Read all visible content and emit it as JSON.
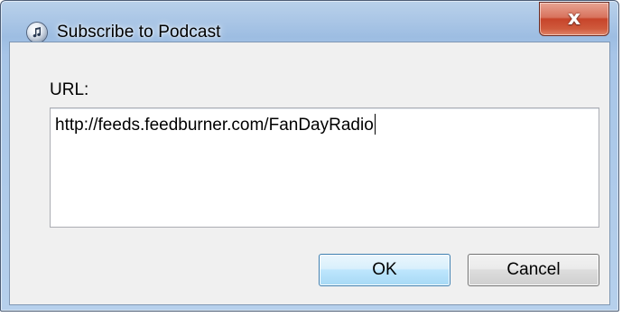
{
  "window": {
    "title": "Subscribe to Podcast",
    "title_icon": "itunes-music-note-icon",
    "close_glyph": "x",
    "close_icon": "close-icon"
  },
  "form": {
    "url_label": "URL:",
    "url_value": "http://feeds.feedburner.com/FanDayRadio"
  },
  "buttons": {
    "ok_label": "OK",
    "cancel_label": "Cancel"
  },
  "colors": {
    "frame": "#a7c5e7",
    "client": "#f0f0f0",
    "close_red": "#c7442a",
    "ok_highlight": "#bee6fd"
  }
}
